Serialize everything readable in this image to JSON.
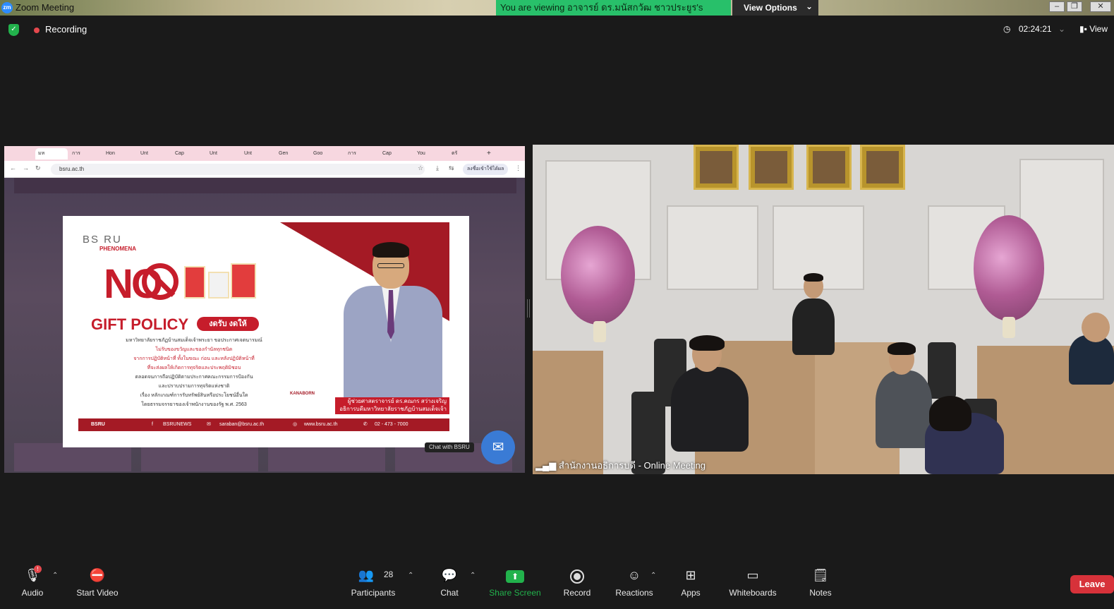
{
  "window": {
    "title": "Zoom Meeting",
    "logo": "zm",
    "viewing_banner": "You are viewing อาจารย์ ดร.มนัสกวัฒ ชาวประยูร's screen",
    "view_options": "View Options",
    "chevron": "⌄"
  },
  "topbar": {
    "recording": "Recording",
    "timer": "02:24:21",
    "view": "View"
  },
  "browser": {
    "tabs": [
      "มห",
      "การ",
      "Hon",
      "Unt",
      "Cap",
      "Unt",
      "Unt",
      "Gen",
      "Goo",
      "การ",
      "Cap",
      "You",
      "ตรั"
    ],
    "url": "bsru.ac.th",
    "right_button": "ลงชื่อเข้าใช้ได้ผล"
  },
  "poster": {
    "logo": "BS RU",
    "logo_sub": "PHENOMENA",
    "no_text": "NO",
    "gift_policy": "GIFT POLICY",
    "pill": "งดรับ งดให้",
    "lines": [
      "มหาวิทยาลัยราชภัฏบ้านสมเด็จเจ้าพระยา ขอประกาศเจตนารมณ์",
      "ไม่รับของขวัญและของกำนัลทุกชนิด",
      "จากการปฏิบัติหน้าที่ ทั้งในขณะ ก่อน และหลังปฏิบัติหน้าที่",
      "ที่จะส่งผลให้เกิดการทุจริตและประพฤติมิชอบ",
      "ตลอดจนการถือปฏิบัติตามประกาศคณะกรรมการป้องกัน",
      "และปราบปรามการทุจริตแห่งชาติ",
      "เรื่อง หลักเกณฑ์การรับทรัพย์สินหรือประโยชน์อื่นใด",
      "โดยธรรมจรรยาของเจ้าพนักงานของรัฐ พ.ศ. 2563"
    ],
    "name_line1": "ผู้ช่วยศาสตราจารย์ ดร.คณกร สว่างเจริญ",
    "name_line2": "อธิการบดีมหาวิทยาลัยราชภัฏบ้านสมเด็จเจ้า",
    "footer": {
      "bsru": "BSRU",
      "facebook": "BSRUNEWS",
      "email": "saraban@bsru.ac.th",
      "web": "www.bsru.ac.th",
      "phone": "02 - 473 - 7000"
    },
    "kanaborn": "KANABORN"
  },
  "cursor_hint": "Chat with BSRU",
  "video": {
    "name_tag": "สำนักงานอธิการบดี - Online Meeting"
  },
  "toolbar": {
    "audio": "Audio",
    "start_video": "Start Video",
    "participants": "Participants",
    "participants_count": "28",
    "chat": "Chat",
    "share_screen": "Share Screen",
    "record": "Record",
    "reactions": "Reactions",
    "apps": "Apps",
    "whiteboards": "Whiteboards",
    "notes": "Notes",
    "leave": "Leave",
    "audio_badge": "!"
  },
  "colors": {
    "share_green": "#22b24c",
    "leave_red": "#d7323a",
    "poster_red": "#c61d2b",
    "banner_green": "#28c06a"
  }
}
